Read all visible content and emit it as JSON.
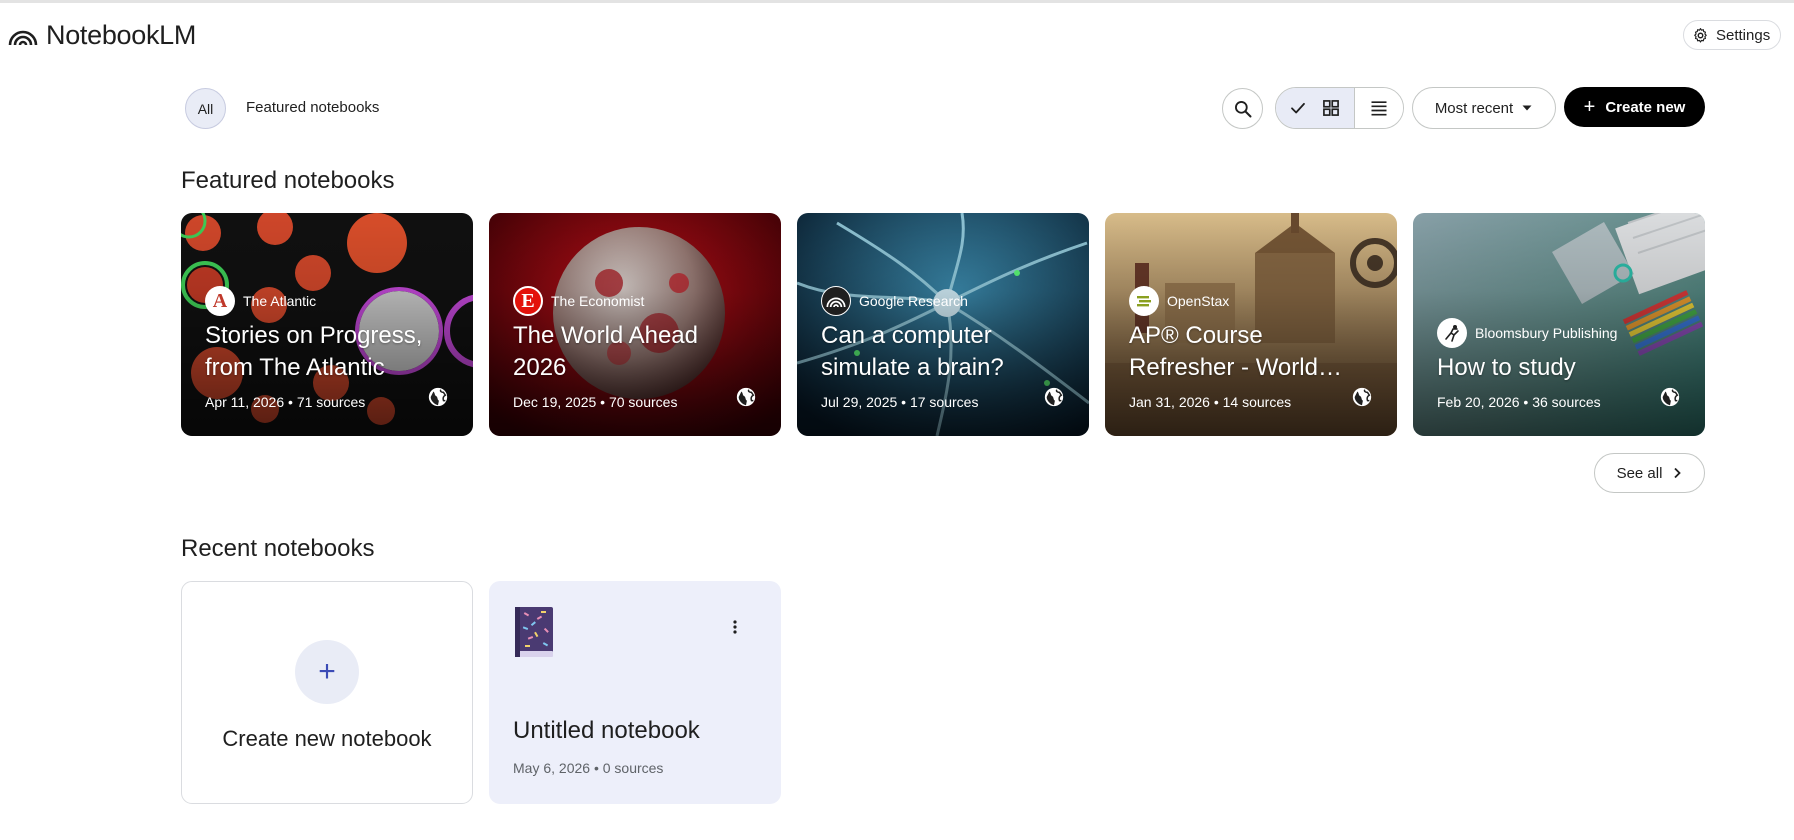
{
  "app": {
    "title": "NotebookLM"
  },
  "header": {
    "settings_label": "Settings"
  },
  "filters": {
    "all_label": "All",
    "featured_label": "Featured notebooks"
  },
  "toolbar": {
    "sort_label": "Most recent",
    "create_label": "Create new"
  },
  "featured": {
    "title": "Featured notebooks",
    "see_all_label": "See all",
    "cards": [
      {
        "publisher": "The Atlantic",
        "title": "Stories on Progress, from The Atlantic",
        "meta": "Apr 11, 2026 • 71 sources",
        "logo_letter": "A"
      },
      {
        "publisher": "The Economist",
        "title": "The World Ahead 2026",
        "meta": "Dec 19, 2025 • 70 sources",
        "logo_letter": "E"
      },
      {
        "publisher": "Google Research",
        "title": "Can a computer simulate a brain?",
        "meta": "Jul 29, 2025 • 17 sources"
      },
      {
        "publisher": "OpenStax",
        "title": "AP® Course Refresher - World History:...",
        "meta": "Jan 31, 2026 • 14 sources"
      },
      {
        "publisher": "Bloomsbury Publishing",
        "title": "How to study",
        "meta": "Feb 20, 2026 • 36 sources"
      }
    ]
  },
  "recent": {
    "title": "Recent notebooks",
    "create_label": "Create new notebook",
    "notebooks": [
      {
        "title": "Untitled notebook",
        "meta": "May 6, 2026 • 0 sources"
      }
    ]
  },
  "colors": {
    "accent": "#3b4bb6",
    "chip_bg": "#e9ecf6",
    "card_bg": "#edeffa",
    "primary_button": "#000000"
  }
}
